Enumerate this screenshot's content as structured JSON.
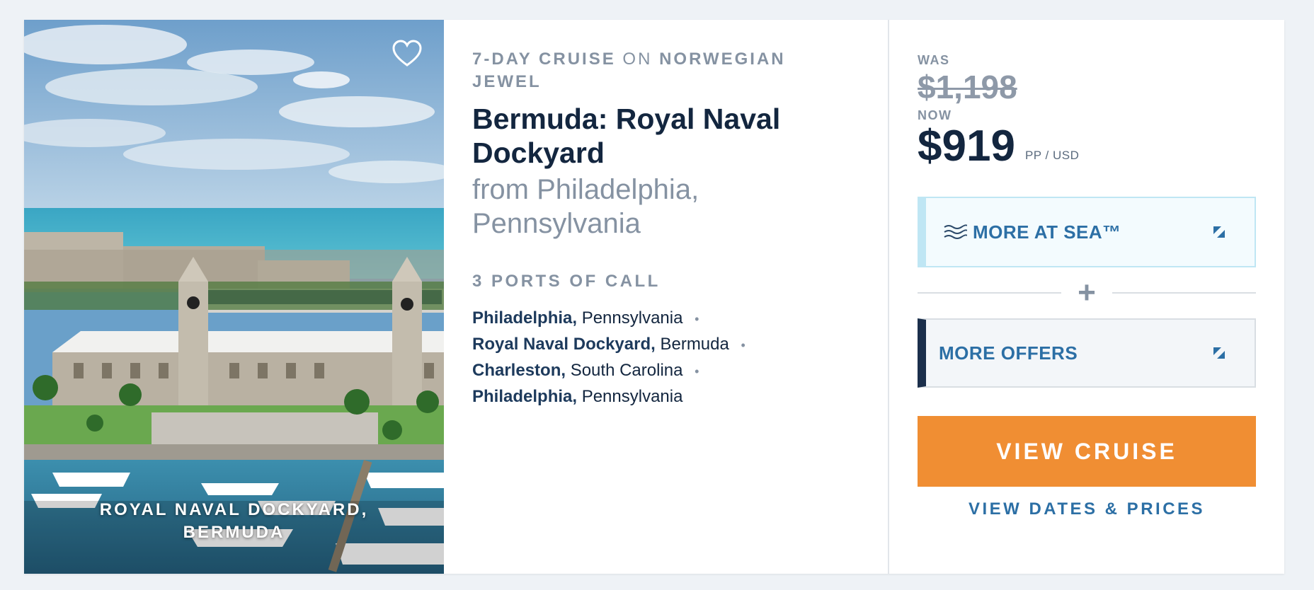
{
  "card": {
    "image": {
      "caption_line1": "ROYAL NAVAL DOCKYARD,",
      "caption_line2": "BERMUDA",
      "favorite_icon": "heart-outline-icon"
    },
    "details": {
      "duration": "7-DAY CRUISE",
      "connector": "ON",
      "ship": "NORWEGIAN JEWEL",
      "title": "Bermuda: Royal Naval Dockyard",
      "subtitle": "from Philadelphia, Pennsylvania",
      "ports_heading": "3 PORTS OF CALL",
      "ports": [
        {
          "city": "Philadelphia,",
          "region": "Pennsylvania"
        },
        {
          "city": "Royal Naval Dockyard,",
          "region": "Bermuda"
        },
        {
          "city": "Charleston,",
          "region": "South Carolina"
        },
        {
          "city": "Philadelphia,",
          "region": "Pennsylvania"
        }
      ],
      "separator": "•"
    },
    "pricing": {
      "was_label": "WAS",
      "was_price": "$1,198",
      "now_label": "NOW",
      "now_price": "$919",
      "unit": "PP / USD",
      "more_at_sea": "MORE AT SEA™",
      "plus": "+",
      "more_offers": "MORE OFFERS",
      "view_cruise": "VIEW CRUISE",
      "view_dates": "VIEW DATES & PRICES"
    }
  },
  "colors": {
    "navy": "#13263f",
    "accent_blue": "#2c6fa5",
    "orange": "#f08e33",
    "muted": "#8592a2",
    "sea_border": "#bfe6f4"
  }
}
